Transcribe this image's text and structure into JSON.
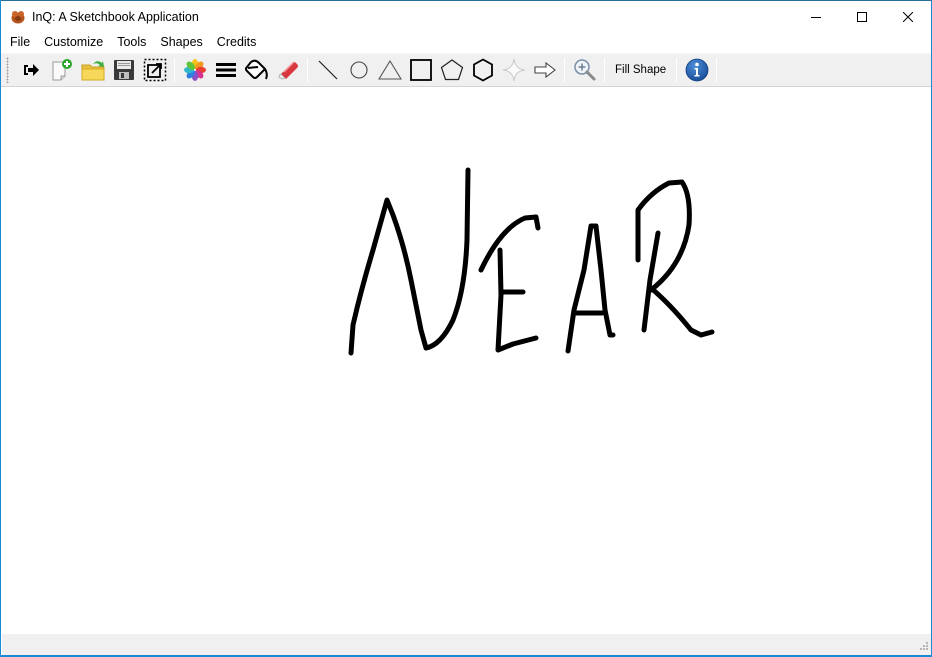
{
  "window": {
    "title": "InQ: A Sketchbook Application",
    "app_icon": "turtle-icon",
    "controls": [
      "minimize-icon",
      "maximize-icon",
      "close-icon"
    ]
  },
  "menubar": {
    "items": [
      {
        "label": "File"
      },
      {
        "label": "Customize"
      },
      {
        "label": "Tools"
      },
      {
        "label": "Shapes"
      },
      {
        "label": "Credits"
      }
    ]
  },
  "toolbar": {
    "groups": [
      [
        "exit-icon",
        "new-file-icon",
        "open-folder-icon",
        "save-icon",
        "select-resize-icon"
      ],
      [
        "color-palette-icon",
        "line-width-icon",
        "paint-bucket-icon",
        "eraser-icon"
      ],
      [
        "line-shape-icon",
        "circle-shape-icon",
        "triangle-shape-icon",
        "square-shape-icon",
        "pentagon-shape-icon",
        "hexagon-shape-icon",
        "star-shape-icon",
        "arrow-shape-icon"
      ],
      [
        "zoom-in-icon"
      ]
    ],
    "fill_shape_label": "Fill Shape",
    "info_icon": "info-icon"
  },
  "canvas": {
    "drawing_text": "NEAR",
    "stroke_color": "#000000",
    "background": "#ffffff"
  },
  "colors": {
    "window_border": "#1a8ad4",
    "toolbar_bg": "#f0f0f0",
    "info_blue": "#1f5fae"
  }
}
